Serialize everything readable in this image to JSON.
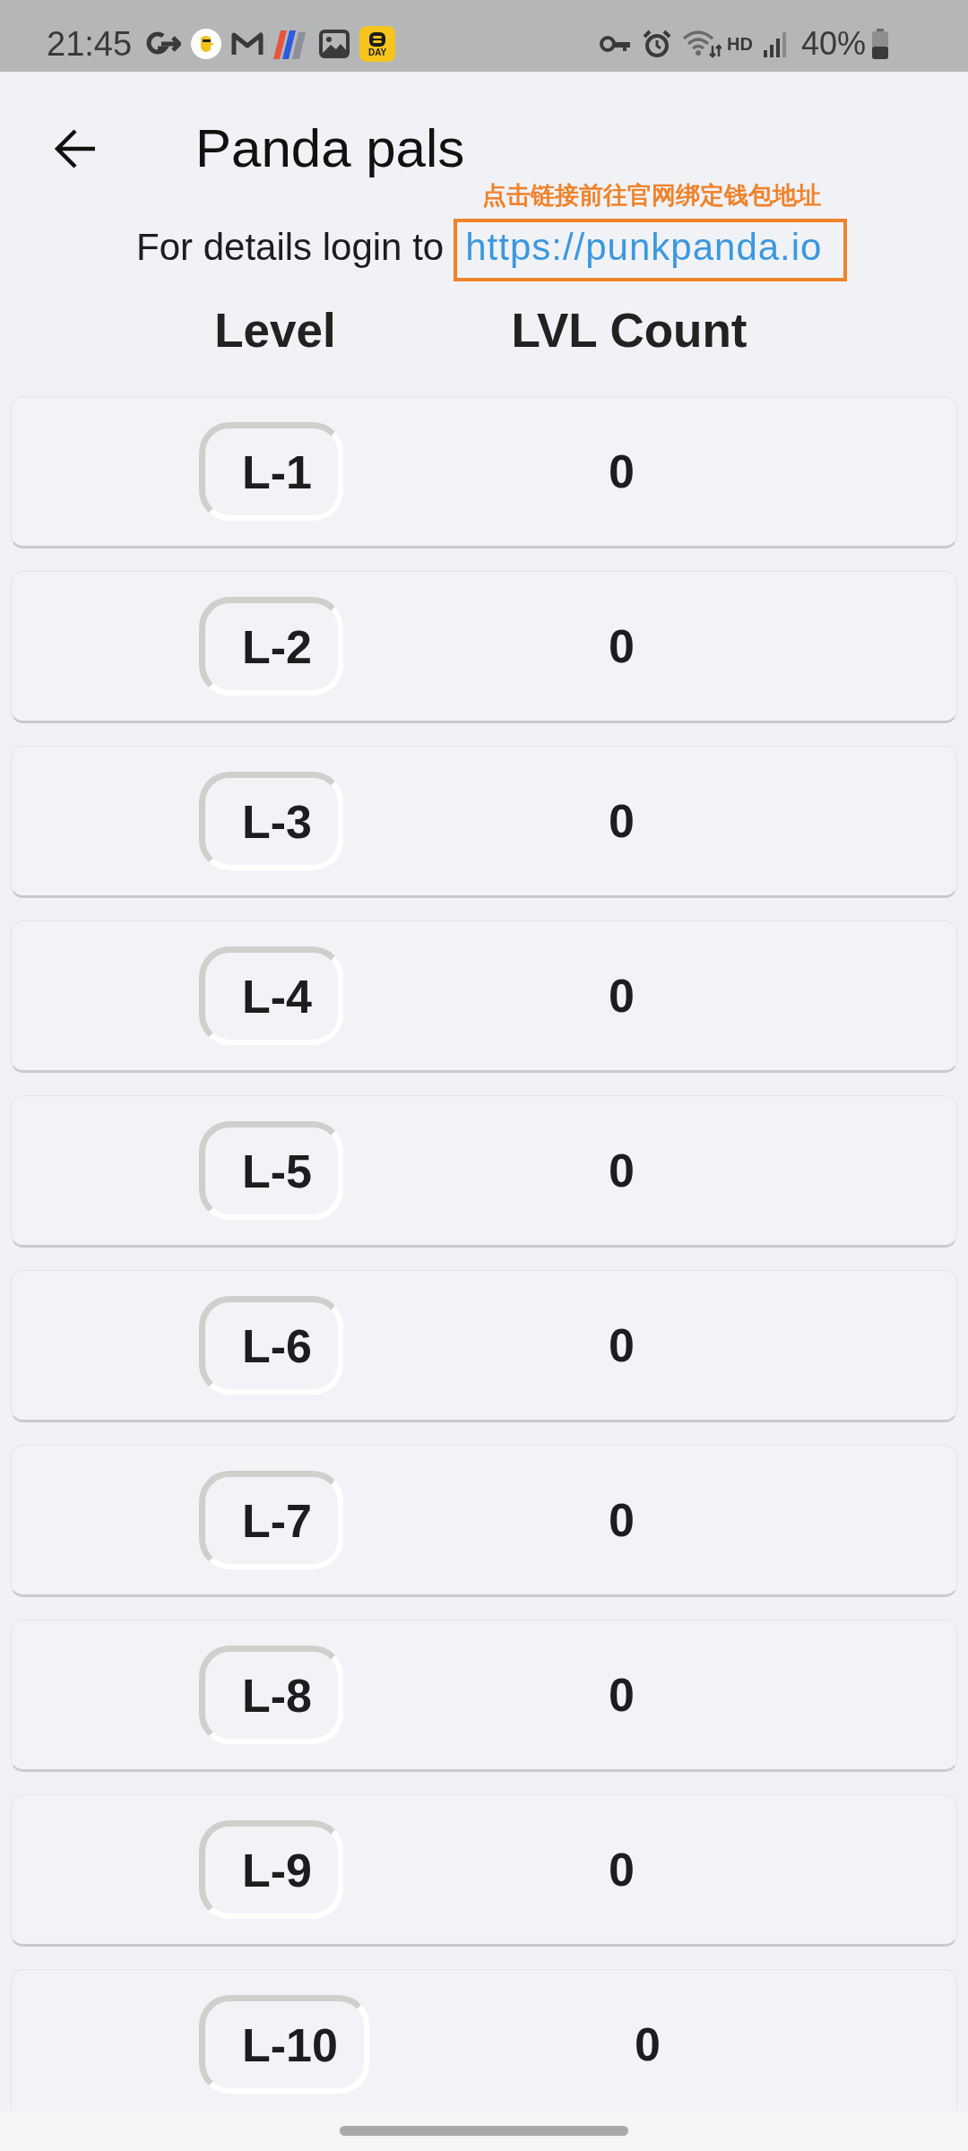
{
  "status_bar": {
    "time": "21:45",
    "app_tile_label": "DAY",
    "network_label": "HD",
    "battery": "40%"
  },
  "header": {
    "title": "Panda pals"
  },
  "info": {
    "text": "For details login to",
    "link": "https://punkpanda.io"
  },
  "annotation": {
    "note": "点击链接前往官网绑定钱包地址",
    "frames_link": true
  },
  "table": {
    "columns": [
      "Level",
      "LVL Count"
    ],
    "rows": [
      {
        "level": "L-1",
        "count": "0"
      },
      {
        "level": "L-2",
        "count": "0"
      },
      {
        "level": "L-3",
        "count": "0"
      },
      {
        "level": "L-4",
        "count": "0"
      },
      {
        "level": "L-5",
        "count": "0"
      },
      {
        "level": "L-6",
        "count": "0"
      },
      {
        "level": "L-7",
        "count": "0"
      },
      {
        "level": "L-8",
        "count": "0"
      },
      {
        "level": "L-9",
        "count": "0"
      },
      {
        "level": "L-10",
        "count": "0"
      }
    ]
  }
}
